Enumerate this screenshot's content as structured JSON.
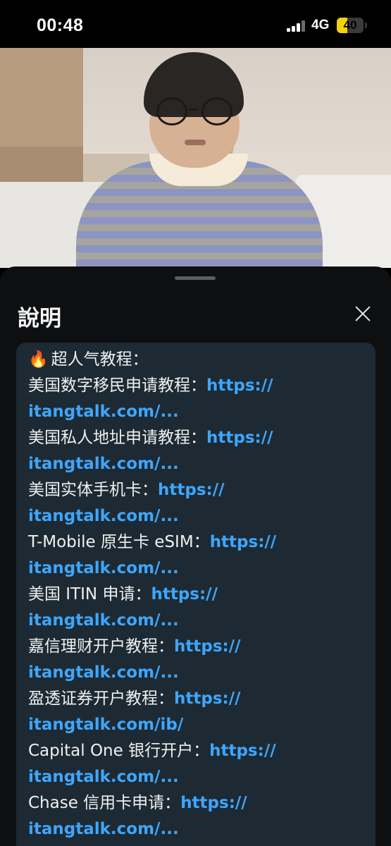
{
  "status_bar": {
    "time": "00:48",
    "network": "4G",
    "battery": "40",
    "battery_fraction": 0.4,
    "battery_color": "#f5d10a"
  },
  "video": {
    "description_icon": "video-frame"
  },
  "sheet": {
    "title": "說明",
    "close_icon": "close-icon"
  },
  "description": {
    "fire_icon": "🔥",
    "heading": "超人气教程：",
    "entries": [
      {
        "label": "美国数字移民申请教程：",
        "link_part1": "https://",
        "link_part2": "itangtalk.com/..."
      },
      {
        "label": "美国私人地址申请教程：",
        "link_part1": "https://",
        "link_part2": "itangtalk.com/..."
      },
      {
        "label": "美国实体手机卡：",
        "link_part1": "https://",
        "link_part2": "itangtalk.com/..."
      },
      {
        "label": "T-Mobile 原生卡 eSIM：",
        "link_part1": "https://",
        "link_part2": "itangtalk.com/..."
      },
      {
        "label": "美国 ITIN 申请：",
        "link_part1": "https://",
        "link_part2": "itangtalk.com/..."
      },
      {
        "label": "嘉信理财开户教程：",
        "link_part1": "https://",
        "link_part2": "itangtalk.com/..."
      },
      {
        "label": "盈透证券开户教程：",
        "link_part1": "https://",
        "link_part2": "itangtalk.com/ib/"
      },
      {
        "label": "Capital One 银行开户：",
        "link_part1": "https://",
        "link_part2": "itangtalk.com/..."
      },
      {
        "label": "Chase 信用卡申请：",
        "link_part1": "https://",
        "link_part2": "itangtalk.com/..."
      }
    ],
    "link_color": "#3ea6ff"
  }
}
